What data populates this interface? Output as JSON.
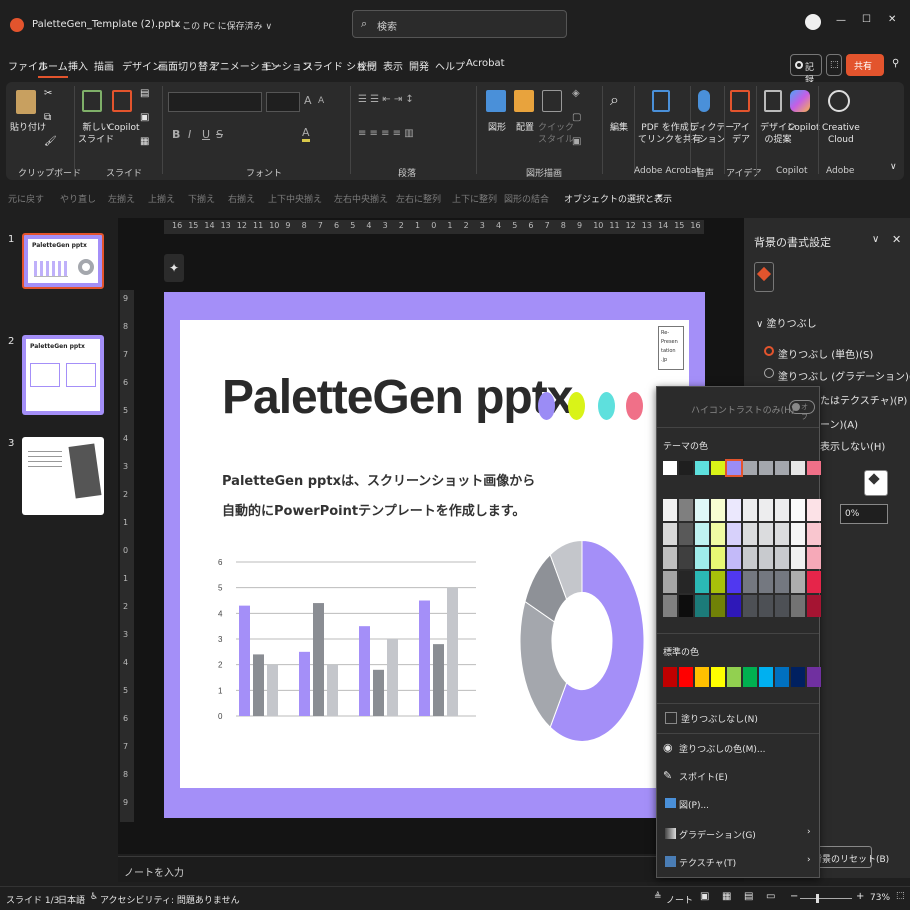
{
  "titlebar": {
    "filename": "PaletteGen_Template (2).pptx",
    "save_status": "• この PC に保存済み ∨",
    "search_placeholder": "検索",
    "minimize": "—",
    "maximize": "☐",
    "close": "✕"
  },
  "menu": {
    "tabs": [
      "ファイル",
      "ホーム",
      "挿入",
      "描画",
      "デザイン",
      "画面切り替え",
      "アニメーション",
      "モーション",
      "スライド ショー",
      "校閲",
      "表示",
      "開発",
      "ヘルプ",
      "Acrobat"
    ],
    "record": "記録",
    "share": "共有"
  },
  "ribbon": {
    "paste": "貼り付け",
    "new_slide": "新しい\nスライド",
    "copilot_small": "Copilot",
    "group_clipboard": "クリップボード",
    "group_slides": "スライド",
    "group_font": "フォント",
    "group_paragraph": "段落",
    "group_drawing": "図形描画",
    "shape": "図形",
    "arrange": "配置",
    "quick_style": "クイック\nスタイル",
    "edit": "編集",
    "pdf_share": "PDF を作成し\nてリンクを共有",
    "group_acrobat": "Adobe Acrobat",
    "dictate": "ディクテー\nション",
    "group_voice": "音声",
    "idea": "アイ\nデア",
    "group_design": "アイデア",
    "design_proposal": "デザイン\nの提案",
    "copilot": "Copilot",
    "group_copilot": "Copilot",
    "creative_cloud": "Creative\nCloud",
    "group_adobe": "Adobe",
    "font_bold": "B",
    "font_italic": "I",
    "font_underline": "U",
    "font_strike": "S",
    "font_grow": "A",
    "font_shrink": "A"
  },
  "qat": {
    "items": [
      "元に戻す",
      "やり直し",
      "左揃え",
      "上揃え",
      "下揃え",
      "右揃え",
      "上下中央揃え",
      "左右中央揃え",
      "左右に整列",
      "上下に整列",
      "図形の結合",
      "オブジェクトの選択と表示"
    ]
  },
  "thumbnails": {
    "numbers": [
      "1",
      "2",
      "3"
    ],
    "slide1_title": "PaletteGen pptx",
    "slide2_title": "PaletteGen pptx"
  },
  "ruler": {
    "h_labels": [
      "16",
      "15",
      "14",
      "13",
      "12",
      "11",
      "10",
      "9",
      "8",
      "7",
      "6",
      "5",
      "4",
      "3",
      "2",
      "1",
      "0",
      "1",
      "2",
      "3",
      "4",
      "5",
      "6",
      "7",
      "8",
      "9",
      "10",
      "11",
      "12",
      "13",
      "14",
      "15",
      "16"
    ],
    "v_labels": [
      "9",
      "8",
      "7",
      "6",
      "5",
      "4",
      "3",
      "2",
      "1",
      "0",
      "1",
      "2",
      "3",
      "4",
      "5",
      "6",
      "7",
      "8",
      "9"
    ]
  },
  "slide": {
    "title": "PaletteGen pptx",
    "desc_line1": "PaletteGen pptxは、スクリーンショット画像から",
    "desc_line2": "自動的にPowerPointテンプレートを作成します。",
    "logo_text": "Re-\nPresen\ntation\n.jp",
    "dots": [
      "#9b8cf5",
      "#d9f318",
      "#5ee0dd",
      "#f07088"
    ]
  },
  "chart_data": [
    {
      "type": "bar",
      "categories": [
        "1",
        "2",
        "3",
        "4"
      ],
      "series": [
        {
          "values": [
            4.3,
            2.5,
            3.5,
            4.5
          ],
          "color": "#a48ff8"
        },
        {
          "values": [
            2.4,
            4.4,
            1.8,
            2.8
          ],
          "color": "#8a8d93"
        },
        {
          "values": [
            2.0,
            2.0,
            3.0,
            5.0
          ],
          "color": "#c4c6cb"
        }
      ],
      "ylim": [
        0,
        6
      ],
      "yticks": [
        "0",
        "1",
        "2",
        "3",
        "4",
        "5",
        "6"
      ],
      "grid": true
    },
    {
      "type": "pie",
      "donut": true,
      "values": [
        8.2,
        3.2,
        1.4,
        1.2
      ],
      "colors": [
        "#a48ff8",
        "#a4a7ad",
        "#8e9197",
        "#c4c6cb"
      ]
    }
  ],
  "right_pane": {
    "title": "背景の書式設定",
    "section": "塗りつぶし",
    "radio_solid": "塗りつぶし (単色)(S)",
    "radio_gradient": "塗りつぶし (グラデーション)(G)",
    "radio_picture_partial": "たはテクスチャ)(P)",
    "radio_pattern_partial": "ーン)(A)",
    "hide_partial": "表示しない(H)",
    "transparency_value": "0%",
    "reset": "背景のリセット(B)"
  },
  "dropdown": {
    "high_contrast": "ハイコントラストのみ(H)",
    "toggle": "オフ",
    "theme_colors": "テーマの色",
    "standard_colors": "標準の色",
    "no_fill": "塗りつぶしなし(N)",
    "more_colors": "塗りつぶしの色(M)...",
    "eyedropper": "スポイト(E)",
    "picture": "図(P)...",
    "gradient": "グラデーション(G)",
    "texture": "テクスチャ(T)",
    "theme_top": [
      "#ffffff",
      "#1f1f1f",
      "#5ee0dd",
      "#d9f318",
      "#9b8cf5",
      "#a4a7ad",
      "#a4a7ad",
      "#a4a7ad",
      "#e6e6e6",
      "#f07088"
    ],
    "theme_shades": [
      [
        "#f2f2f2",
        "#d9d9d9",
        "#bfbfbf",
        "#a6a6a6",
        "#808080"
      ],
      [
        "#7f7f7f",
        "#595959",
        "#3f3f3f",
        "#262626",
        "#0d0d0d"
      ],
      [
        "#dff8f8",
        "#bff2f1",
        "#9fecea",
        "#2bb9b5",
        "#1c7b79"
      ],
      [
        "#f7fdd1",
        "#f0fba3",
        "#e8f874",
        "#a8c10a",
        "#708107"
      ],
      [
        "#ebe8fd",
        "#d7d1fb",
        "#c3baf9",
        "#5038f0",
        "#2e18b8"
      ],
      [
        "#ededee",
        "#dbdcde",
        "#c8cace",
        "#747880",
        "#4d5055"
      ],
      [
        "#ededee",
        "#dbdcde",
        "#c8cace",
        "#747880",
        "#4d5055"
      ],
      [
        "#ededee",
        "#dbdcde",
        "#c8cace",
        "#747880",
        "#4d5055"
      ],
      [
        "#fafafa",
        "#f5f5f5",
        "#f0f0f0",
        "#adadad",
        "#737373"
      ],
      [
        "#fce2e7",
        "#f9c6cf",
        "#f6a9b8",
        "#e6254a",
        "#a51432"
      ]
    ],
    "standard": [
      "#c00000",
      "#ff0000",
      "#ffc000",
      "#ffff00",
      "#92d050",
      "#00b050",
      "#00b0f0",
      "#0070c0",
      "#002060",
      "#7030a0"
    ]
  },
  "status": {
    "slide": "スライド 1/3",
    "lang": "日本語",
    "accessibility": "アクセシビリティ: 問題ありません",
    "notes": "ノート",
    "zoom": "73%"
  },
  "notes_placeholder": "ノートを入力"
}
